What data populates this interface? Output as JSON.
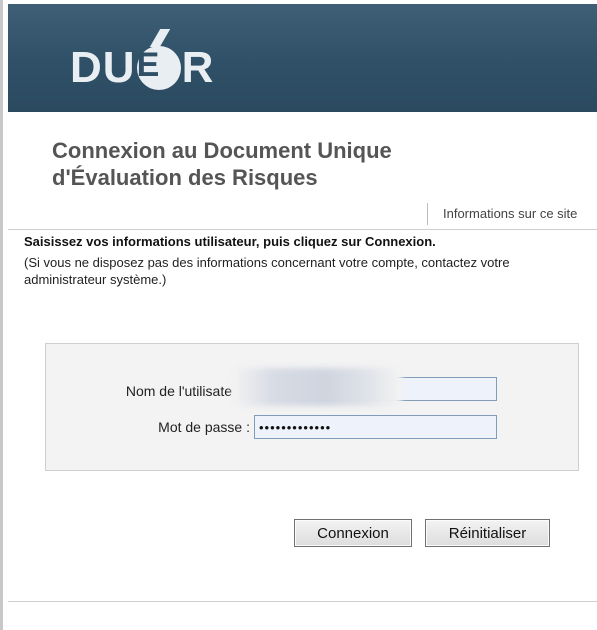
{
  "header": {
    "logo": {
      "letters_before": "D",
      "letter_u": "U",
      "letter_e_circled": "E",
      "letters_after": "R"
    },
    "title": "Connexion au Document Unique d'Évaluation des Risques",
    "info_link": "Informations sur ce site"
  },
  "instructions": {
    "bold": "Saisissez vos informations utilisateur, puis cliquez sur Connexion.",
    "note": "(Si vous ne disposez pas des informations concernant votre compte, contactez votre administrateur système.)"
  },
  "login_form": {
    "username_label": "Nom de l'utilisate",
    "username_value": "",
    "password_label": "Mot de passe :",
    "password_value": "•••••••••••••"
  },
  "buttons": {
    "connect": "Connexion",
    "reset": "Réinitialiser"
  },
  "colors": {
    "banner": "#2f5067",
    "logo": "#e9eef2",
    "field_bg": "#eef2fb",
    "field_border": "#7f9db9"
  }
}
